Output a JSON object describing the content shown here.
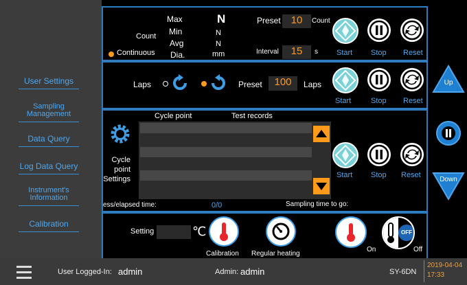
{
  "sidebar": {
    "items": [
      {
        "label": "User Settings"
      },
      {
        "label": "Sampling\nManagement"
      },
      {
        "label": "Data Query"
      },
      {
        "label": "Log Data Query"
      },
      {
        "label": "Instrument's\nInformation"
      },
      {
        "label": "Calibration"
      }
    ]
  },
  "count_panel": {
    "count_label": "Count",
    "continuous_label": "Continuous",
    "stats": [
      "Max",
      "Min",
      "Avg",
      "Dia."
    ],
    "unit_header": "N",
    "units": [
      "N",
      "N",
      "mm"
    ],
    "preset_label": "Preset",
    "preset_value": "10",
    "preset_unit": "Count",
    "interval_label": "Interval",
    "interval_value": "15",
    "interval_unit": "s",
    "start": "Start",
    "stop": "Stop",
    "reset": "Reset"
  },
  "laps_panel": {
    "laps_label": "Laps",
    "preset_label": "Preset",
    "preset_value": "100",
    "preset_unit": "Laps",
    "start": "Start",
    "stop": "Stop",
    "reset": "Reset"
  },
  "cycle_panel": {
    "col_cycle_point": "Cycle point",
    "col_test_records": "Test records",
    "settings_label": "Cycle\npoint\nSettings",
    "elapsed_label": "ess/elapsed time:",
    "progress": "0/0",
    "time_to_go_label": "Sampling time to go:",
    "start": "Start",
    "stop": "Stop",
    "reset": "Reset"
  },
  "heat_panel": {
    "setting_label": "Setting",
    "unit": "℃",
    "calibration_label": "Calibration",
    "regular_heating_label": "Regular heating",
    "on_label": "On",
    "off_label": "Off",
    "toggle_text": "OFF"
  },
  "right": {
    "up": "Up",
    "down": "Down"
  },
  "status": {
    "user_label": "User Logged-In:",
    "user_value": "admin",
    "admin_label": "Admin:",
    "admin_value": "admin",
    "device": "SY-6DN",
    "date": "2019-04-04",
    "time": "17:33"
  },
  "colors": {
    "accent": "#2f7dc1",
    "button_teal": "#79d2d8",
    "value_orange": "#ff9a1a",
    "thermo_red": "#e8262b",
    "date_color": "#e8a24a"
  }
}
